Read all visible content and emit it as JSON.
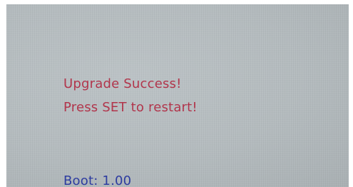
{
  "screen": {
    "message_line_1": "Upgrade Success!",
    "message_line_2": "Press SET to restart!",
    "boot_version": "Boot: 1.00"
  },
  "colors": {
    "message": "#b2334a",
    "boot": "#2b3aa0",
    "background": "#b4bbbe"
  }
}
